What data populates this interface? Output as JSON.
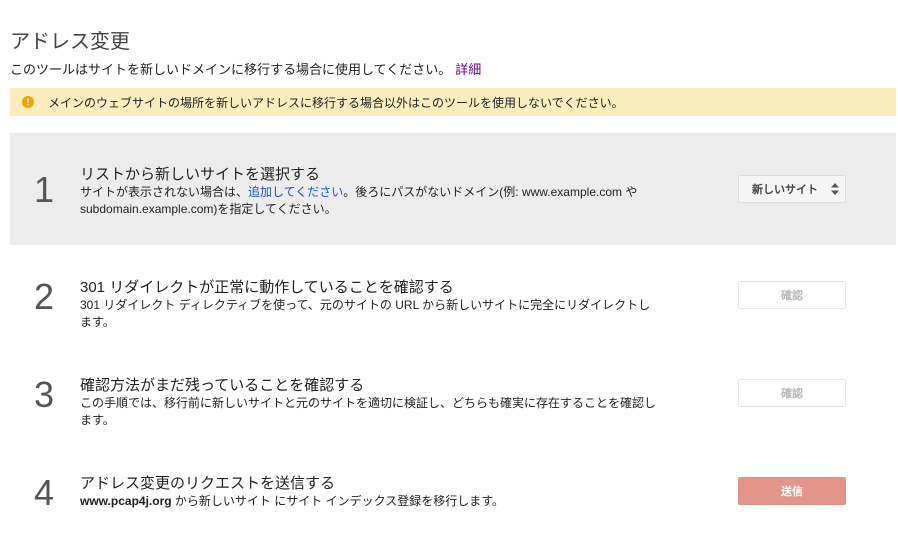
{
  "page": {
    "title": "アドレス変更",
    "intro_text": "このツールはサイトを新しいドメインに移行する場合に使用してください。",
    "intro_link": "詳細"
  },
  "warning": {
    "icon": "!",
    "text": "メインのウェブサイトの場所を新しいアドレスに移行する場合以外はこのツールを使用しないでください。"
  },
  "steps": [
    {
      "number": "1",
      "title": "リストから新しいサイトを選択する",
      "desc_pre": "サイトが表示されない場合は、",
      "desc_link": "追加してください",
      "desc_post": "。後ろにパスがないドメイン(例: www.example.com や subdomain.example.com)を指定してください。",
      "button_label": "新しいサイト",
      "button_icon": "updown-icon"
    },
    {
      "number": "2",
      "title": "301 リダイレクトが正常に動作していることを確認する",
      "desc": "301 リダイレクト ディレクティブを使って、元のサイトの URL から新しいサイトに完全にリダイレクトします。",
      "button_label": "確認"
    },
    {
      "number": "3",
      "title": "確認方法がまだ残っていることを確認する",
      "desc": "この手順では、移行前に新しいサイトと元のサイトを適切に検証し、どちらも確実に存在することを確認します。",
      "button_label": "確認"
    },
    {
      "number": "4",
      "title": "アドレス変更のリクエストを送信する",
      "desc_bold": "www.pcap4j.org",
      "desc_post": " から新しいサイト にサイト インデックス登録を移行します。",
      "button_label": "送信"
    }
  ],
  "colors": {
    "warning_bg": "#f9edbe",
    "active_step_bg": "#ececec",
    "link": "#1155cc",
    "visited_link": "#660099",
    "submit_button": "#e4958b"
  }
}
